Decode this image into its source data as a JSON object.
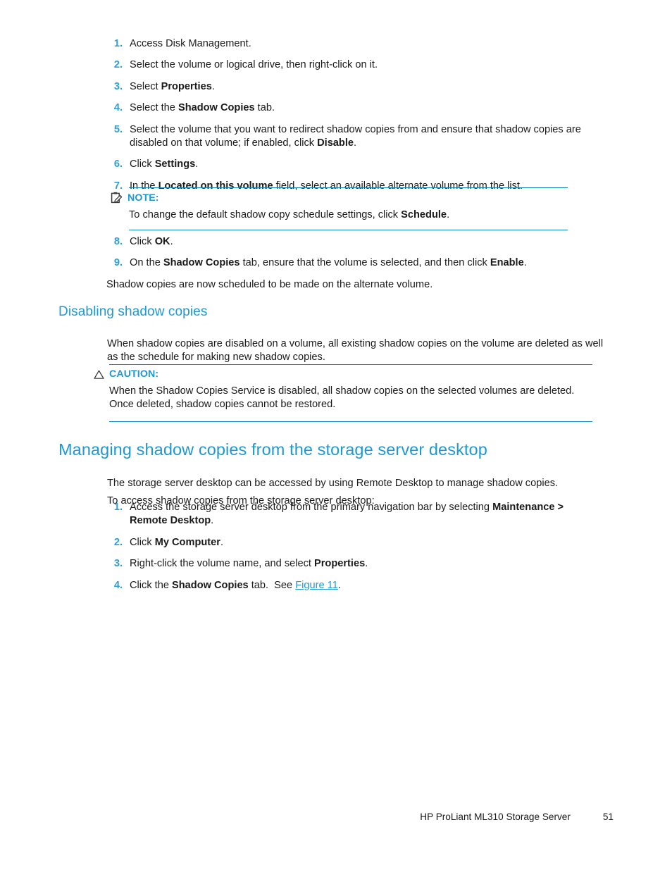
{
  "page": {
    "footer_title": "HP ProLiant ML310 Storage Server",
    "page_number": "51"
  },
  "colors": {
    "accent_blue": "#2098d1",
    "rule_blue": "#0c84bd",
    "number_blue": "#2e9fd8",
    "body_text": "#1a1a1a"
  },
  "steps_block_1": {
    "items": [
      {
        "num": "1.",
        "text": "Access Disk Management."
      },
      {
        "num": "2.",
        "text": "Select the volume or logical drive, then right-click on it."
      },
      {
        "num": "3.",
        "text": "Select Properties."
      },
      {
        "num": "4.",
        "text": "Select the Shadow Copies tab."
      },
      {
        "num": "5.",
        "text": "Select the volume that you want to redirect shadow copies from and ensure that shadow copies are disabled on that volume; if enabled, click Disable."
      },
      {
        "num": "6.",
        "text": "Click Settings."
      },
      {
        "num": "7.",
        "text": "In the Located on this volume field, select an available alternate volume from the list."
      }
    ]
  },
  "note_box": {
    "icon": "note-clipboard-icon",
    "title": "NOTE:",
    "body": "To change the default shadow copy schedule settings, click Schedule."
  },
  "steps_block_2": {
    "items": [
      {
        "num": "8.",
        "text": "Click OK."
      },
      {
        "num": "9.",
        "text": "On the Shadow Copies tab, ensure that the volume is selected, and then click Enable."
      }
    ],
    "trailing_paragraph": "Shadow copies are now scheduled to be made on the alternate volume."
  },
  "section_disabling": {
    "heading": "Disabling shadow copies",
    "paragraph": "When shadow copies are disabled on a volume, all existing shadow copies on the volume are deleted as well as the schedule for making new shadow copies."
  },
  "caution_box": {
    "icon": "warning-triangle-icon",
    "title": "CAUTION:",
    "body": "When the Shadow Copies Service is disabled, all shadow copies on the selected volumes are deleted. Once deleted, shadow copies cannot be restored."
  },
  "section_managing": {
    "heading": "Managing shadow copies from the storage server desktop",
    "paragraph_1": "The storage server desktop can be accessed by using Remote Desktop to manage shadow copies.",
    "paragraph_2": "To access shadow copies from the storage server desktop:",
    "steps": [
      {
        "num": "1.",
        "text": "Access the storage server desktop from the primary navigation bar by selecting Maintenance > Remote Desktop."
      },
      {
        "num": "2.",
        "text": "Click My Computer."
      },
      {
        "num": "3.",
        "text": "Right-click the volume name, and select Properties."
      },
      {
        "num": "4.",
        "text": "Click the Shadow Copies tab.  See Figure 11."
      }
    ],
    "figure_link": "Figure 11"
  }
}
